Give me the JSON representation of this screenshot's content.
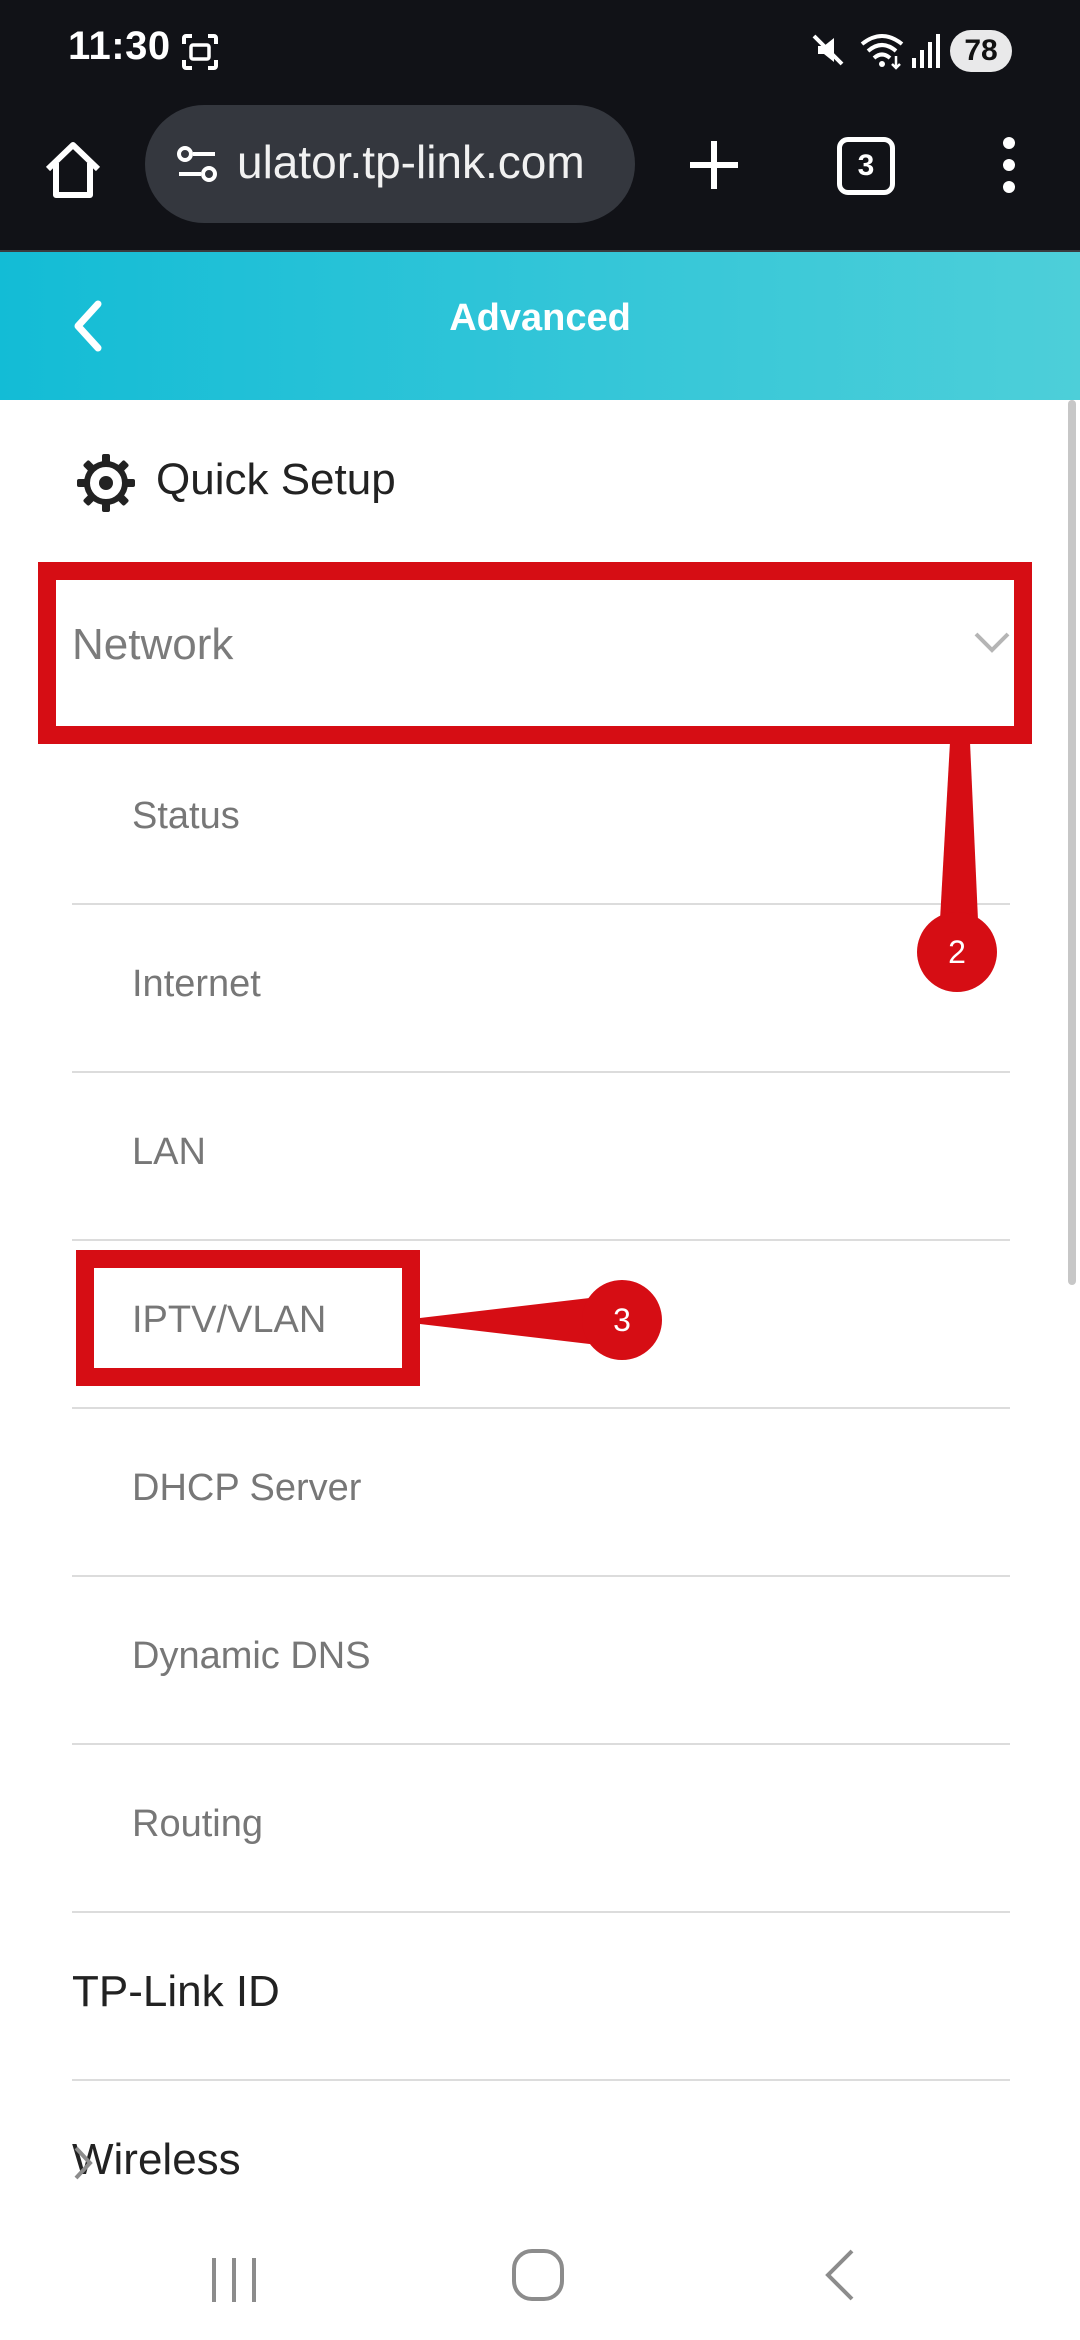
{
  "status_bar": {
    "time": "11:30",
    "battery": "78",
    "icons": [
      "screenshot-icon",
      "mute-icon",
      "wifi-icon",
      "signal-icon"
    ]
  },
  "browser": {
    "url": "ulator.tp-link.com",
    "tab_count": "3",
    "icons": [
      "home-icon",
      "site-settings-icon",
      "plus-icon",
      "more-vert-icon"
    ]
  },
  "header": {
    "title": "Advanced",
    "back_icon": "chevron-left-icon"
  },
  "menu": {
    "quick_setup": "Quick Setup",
    "network": {
      "label": "Network",
      "expanded": true,
      "items": [
        {
          "label": "Status"
        },
        {
          "label": "Internet"
        },
        {
          "label": "LAN"
        },
        {
          "label": "IPTV/VLAN"
        },
        {
          "label": "DHCP Server"
        },
        {
          "label": "Dynamic DNS"
        },
        {
          "label": "Routing"
        }
      ]
    },
    "tplink_id": "TP-Link ID",
    "wireless": "Wireless"
  },
  "annotations": [
    {
      "number": "2",
      "target": "Network"
    },
    {
      "number": "3",
      "target": "IPTV/VLAN"
    }
  ],
  "colors": {
    "status_bar_bg": "#111217",
    "header_gradient_start": "#13bcd6",
    "header_gradient_end": "#4dcfd9",
    "annotation_red": "#d60d14"
  },
  "nav_bar": {
    "buttons": [
      "recents-icon",
      "home-circle-icon",
      "back-icon"
    ]
  }
}
